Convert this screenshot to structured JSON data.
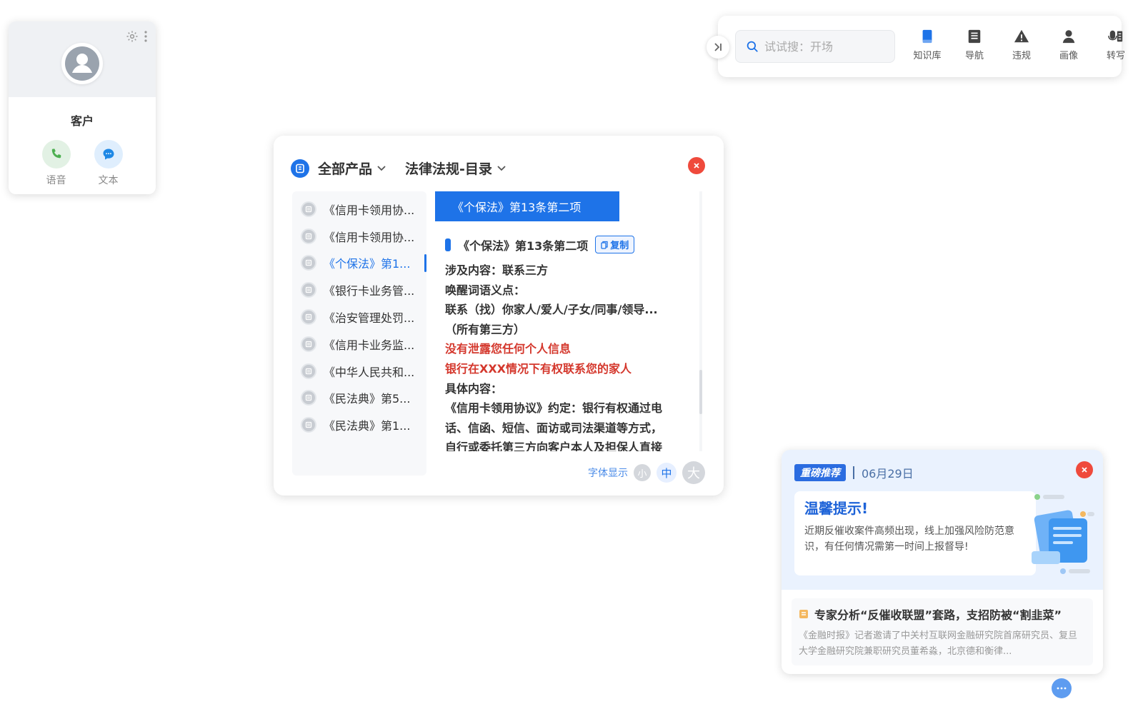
{
  "customer": {
    "name": "客户",
    "actions": [
      {
        "label": "语音",
        "icon": "phone-icon"
      },
      {
        "label": "文本",
        "icon": "chat-icon"
      }
    ]
  },
  "toolbar": {
    "search_placeholder": "试试搜：开场",
    "nav": [
      {
        "label": "知识库",
        "icon": "book-icon"
      },
      {
        "label": "导航",
        "icon": "list-icon"
      },
      {
        "label": "违规",
        "icon": "warning-icon"
      },
      {
        "label": "画像",
        "icon": "user-icon"
      },
      {
        "label": "转写",
        "icon": "transcribe-icon"
      }
    ]
  },
  "panel": {
    "product_dropdown": "全部产品",
    "category_dropdown": "法律法规-目录",
    "list": [
      "《信用卡领用协...",
      "《信用卡领用协...",
      "《个保法》第1...",
      "《银行卡业务管...",
      "《治安管理处罚...",
      "《信用卡业务监...",
      "《中华人民共和...",
      "《民法典》第5...",
      "《民法典》第1..."
    ],
    "active_index": 2,
    "tab": "《个保法》第13条第二项",
    "article_title": "《个保法》第13条第二项",
    "copy_label": "复制",
    "lines": {
      "l1": "涉及内容：联系三方",
      "l2": "唤醒词语义点：",
      "l3": "联系（找）你家人/爱人/子女/同事/领导...",
      "l4": "（所有第三方）",
      "l5": "没有泄露您任何个人信息",
      "l6": "银行在XXX情况下有权联系您的家人",
      "l7": "具体内容：",
      "l8": "《信用卡领用协议》约定：银行有权通过电",
      "l9": "话、信函、短信、面访或司法渠道等方式，",
      "l10": "自行或委托第三方向客户本人及担保人直接"
    },
    "font_label": "字体显示",
    "font_options": [
      "小",
      "中",
      "大"
    ],
    "font_active": 1
  },
  "reco": {
    "badge": "重磅推荐",
    "date": "06月29日",
    "tip_title": "温馨提示!",
    "tip_text": "近期反催收案件高频出现，线上加强风险防范意识，有任何情况需第一时间上报督导!",
    "news_title": "专家分析“反催收联盟”套路，支招防被“割韭菜”",
    "news_text": "《金融时报》记者邀请了中关村互联网金融研究院首席研究员、复旦大学金融研究院兼职研究员董希淼，北京德和衡律..."
  },
  "colors": {
    "accent": "#1e73e8",
    "danger": "#ef4a3c",
    "highlight_text": "#d4372c"
  }
}
